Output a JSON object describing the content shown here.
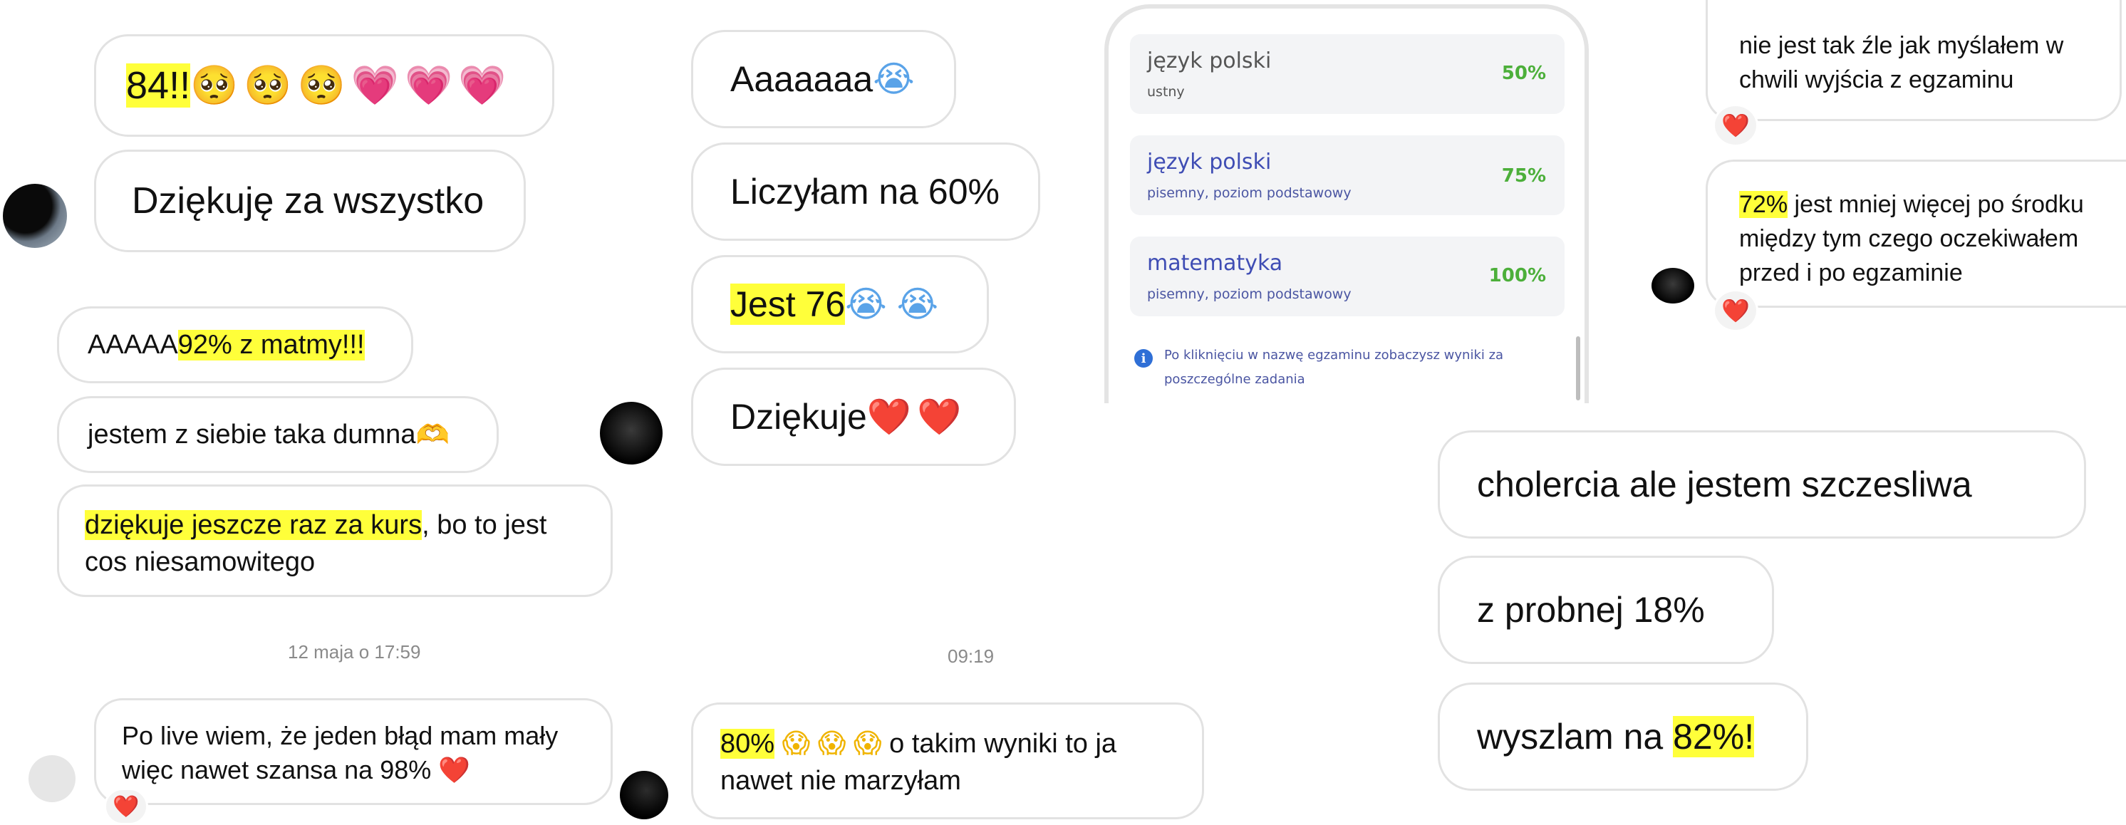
{
  "col1": {
    "top_bubble": {
      "prefix": "84!!",
      "emojis": [
        "🥺",
        "🥺",
        "🥺",
        "💗",
        "💗",
        "💗"
      ]
    },
    "thanks": "Dziękuję za wszystko",
    "msg_matmy": {
      "plain": "AAAAA ",
      "highlight": "92% z matmy!!!"
    },
    "msg_dumna": {
      "text": "jestem z siebie taka dumna",
      "emoji": "🫶"
    },
    "msg_kurs": {
      "highlight": "dziękuje jeszcze raz za kurs",
      "rest": ", bo to jest cos niesamowitego"
    },
    "timestamp": "12 maja o 17:59",
    "msg_live": {
      "text": "Po live wiem, że jeden błąd mam mały więc nawet szansa na 98% ",
      "emoji": "❤️"
    },
    "reaction": "❤️"
  },
  "col2": {
    "msg_a": {
      "text": "Aaaaaaa",
      "emoji": "😭"
    },
    "msg_liczylam": "Liczyłam na 60%",
    "msg_jest": {
      "highlight": "Jest 76",
      "emojis": [
        "😭",
        "😭"
      ]
    },
    "msg_dziekuje": {
      "text": "Dziękuje ",
      "emojis": [
        "❤️",
        "❤️"
      ]
    },
    "timestamp": "09:19",
    "msg_80": {
      "highlight": "80%",
      "emojis": [
        "😱",
        "😱",
        "😱"
      ],
      "rest": " o takim wyniki to ja nawet nie marzyłam"
    }
  },
  "exam_results": {
    "rows": [
      {
        "subject": "język polski",
        "type": "ustny",
        "percent": "50%",
        "subject_color": "#555555",
        "type_color": "#555555"
      },
      {
        "subject": "język polski",
        "type": "pisemny, poziom podstawowy",
        "percent": "75%",
        "subject_color": "#3f4db4",
        "type_color": "#3f4db4"
      },
      {
        "subject": "matematyka",
        "type": "pisemny, poziom podstawowy",
        "percent": "100%",
        "subject_color": "#3f4db4",
        "type_color": "#3f4db4"
      }
    ],
    "info_text": "Po kliknięciu w nazwę egzaminu zobaczysz wyniki za poszczególne zadania",
    "percent_color": "#4caf3a"
  },
  "col4": {
    "msg_nie_jest": "nie jest tak źle jak myślałem w chwili wyjścia z egzaminu",
    "msg_72": {
      "highlight": "72%",
      "rest": " jest mniej więcej po środku między tym czego oczekiwałem przed i po egzaminie"
    },
    "reaction": "❤️",
    "msg_cholercia": "cholercia ale jestem szczesliwa",
    "msg_probnej": "z probnej 18%",
    "msg_wyszlam": {
      "plain": "wyszlam na ",
      "highlight": "82%!"
    }
  },
  "colors": {
    "highlight": "#ffff3a",
    "bubble_border": "#e2e2e2",
    "heart": "#e0201b"
  }
}
